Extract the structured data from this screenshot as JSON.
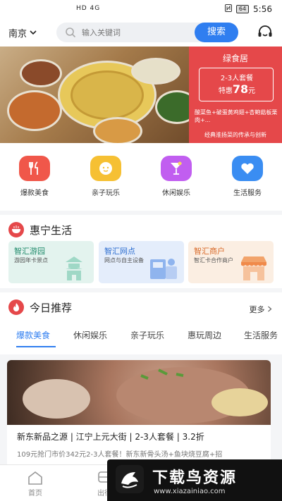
{
  "status_bar": {
    "signal_text": "HD 4G",
    "battery": "64",
    "time": "5:56"
  },
  "header": {
    "city": "南京",
    "search_placeholder": "输入关键词",
    "search_button": "搜索"
  },
  "banner": {
    "restaurant": "绿食居",
    "combo": "2-3人套餐",
    "price_prefix": "特惠",
    "price_value": "78",
    "price_unit": "元",
    "dishes": "酸菜鱼+破蛋黄鸡翅+杏鲍菇板栗肉+...",
    "slogan": "经典淮扬菜的传承与创新"
  },
  "categories": [
    {
      "label": "爆款美食",
      "icon": "fork-knife-icon",
      "color": "#f0574a"
    },
    {
      "label": "亲子玩乐",
      "icon": "smiley-icon",
      "color": "#f6c033"
    },
    {
      "label": "休闲娱乐",
      "icon": "cocktail-icon",
      "color": "#c15ef0"
    },
    {
      "label": "生活服务",
      "icon": "heart-icon",
      "color": "#3a8df2"
    }
  ],
  "huining": {
    "title": "惠宁生活",
    "cards": [
      {
        "title": "智汇游园",
        "desc": "游园年卡景点",
        "bg": "#e3f3ee"
      },
      {
        "title": "智汇网点",
        "desc": "网点与自主设备",
        "bg": "#e4edfb"
      },
      {
        "title": "智汇商户",
        "desc": "智汇卡合作商户",
        "bg": "#fbeee2"
      }
    ]
  },
  "recommend": {
    "title": "今日推荐",
    "more": "更多",
    "tabs": [
      "爆款美食",
      "休闲娱乐",
      "亲子玩乐",
      "惠玩周边",
      "生活服务"
    ],
    "active_tab": 0
  },
  "feed": {
    "title": "新东新品之源 | 江宁上元大街 | 2-3人套餐 | 3.2折",
    "desc": "109元抢门市价342元2-3人套餐！新东新骨头汤+鱼块烧豆腐+招"
  },
  "bottom_nav": [
    {
      "label": "首页"
    },
    {
      "label": "出行"
    }
  ],
  "watermark": {
    "text": "下载鸟资源",
    "url": "www.xiazainiao.com"
  },
  "colors": {
    "accent": "#2f7ef0",
    "brand_red": "#e5484a"
  }
}
